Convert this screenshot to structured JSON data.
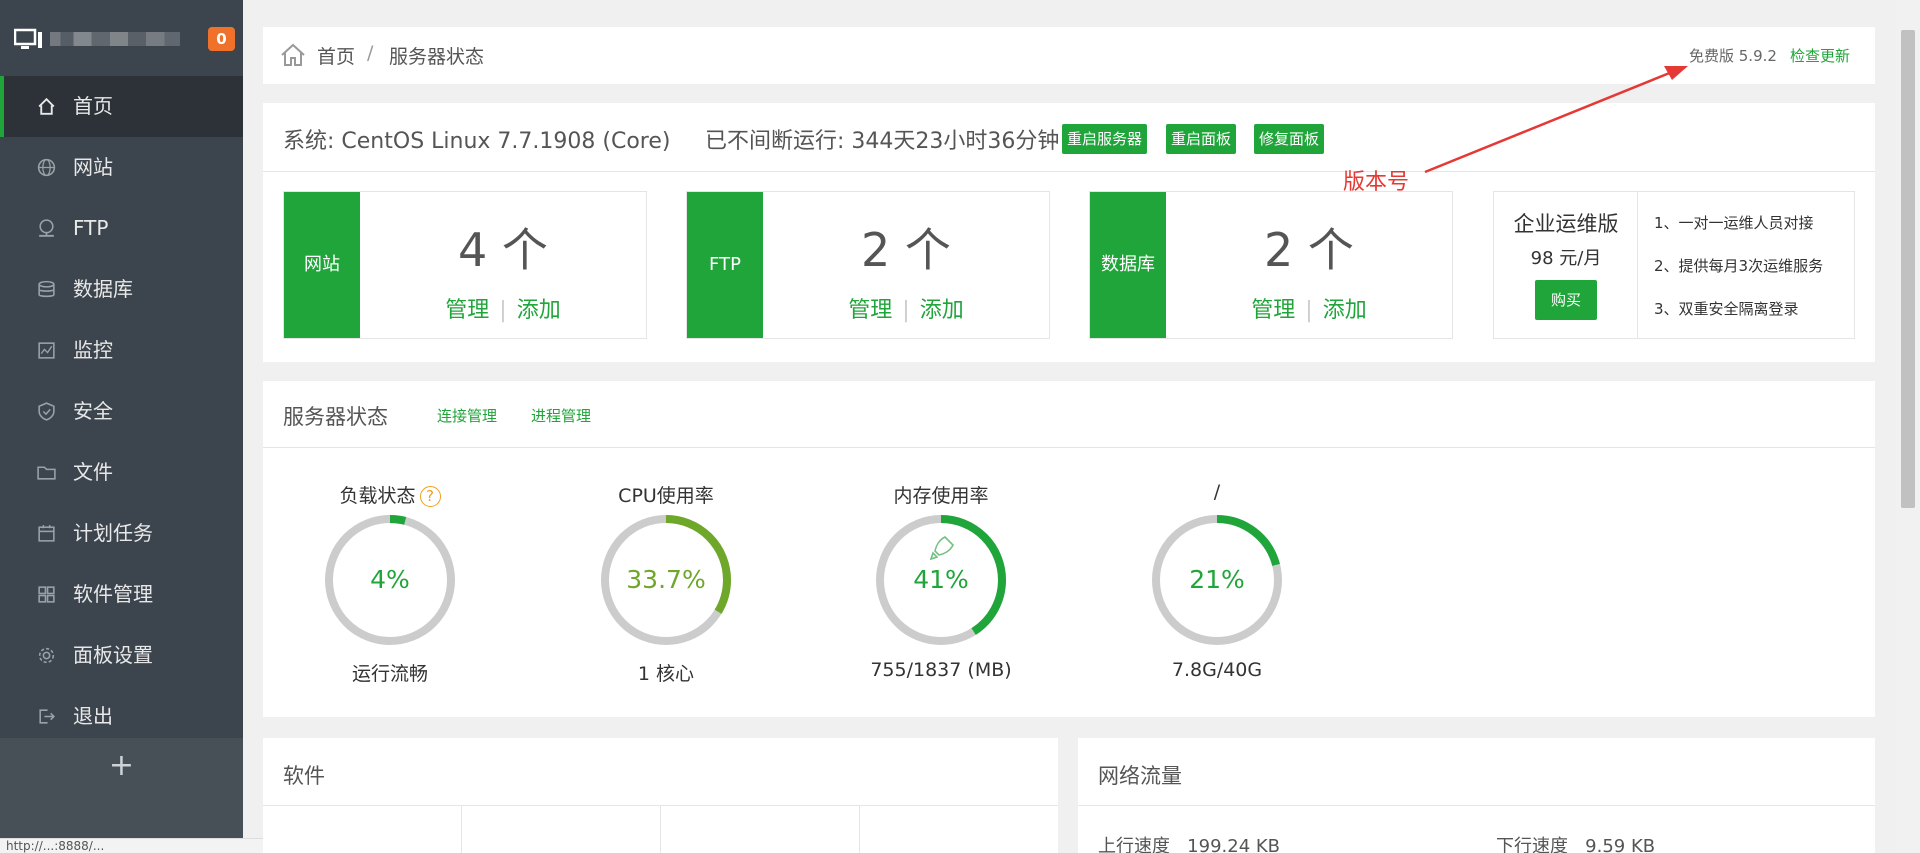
{
  "sidebar": {
    "badge": "0",
    "items": [
      {
        "label": "首页",
        "icon": "home-icon"
      },
      {
        "label": "网站",
        "icon": "globe-icon"
      },
      {
        "label": "FTP",
        "icon": "ftp-icon"
      },
      {
        "label": "数据库",
        "icon": "database-icon"
      },
      {
        "label": "监控",
        "icon": "monitor-chart-icon"
      },
      {
        "label": "安全",
        "icon": "shield-icon"
      },
      {
        "label": "文件",
        "icon": "folder-icon"
      },
      {
        "label": "计划任务",
        "icon": "calendar-icon"
      },
      {
        "label": "软件管理",
        "icon": "grid-icon"
      },
      {
        "label": "面板设置",
        "icon": "gear-icon"
      },
      {
        "label": "退出",
        "icon": "logout-icon"
      }
    ],
    "add_label": "+"
  },
  "breadcrumb": {
    "home": "首页",
    "separator": "/",
    "current": "服务器状态",
    "version": "免费版 5.9.2",
    "update_link": "检查更新"
  },
  "system": {
    "os": "系统: CentOS Linux 7.7.1908 (Core)",
    "uptime": "已不间断运行: 344天23小时36分钟",
    "buttons": [
      "重启服务器",
      "重启面板",
      "修复面板"
    ]
  },
  "stats": [
    {
      "label": "网站",
      "count": "4 个",
      "manage": "管理",
      "add": "添加"
    },
    {
      "label": "FTP",
      "count": "2 个",
      "manage": "管理",
      "add": "添加"
    },
    {
      "label": "数据库",
      "count": "2 个",
      "manage": "管理",
      "add": "添加"
    }
  ],
  "enterprise": {
    "name": "企业运维版",
    "price": "98 元/月",
    "buy": "购买",
    "features": [
      "1、一对一运维人员对接",
      "2、提供每月3次运维服务",
      "3、双重安全隔离登录"
    ]
  },
  "server_status": {
    "title": "服务器状态",
    "conn_link": "连接管理",
    "proc_link": "进程管理",
    "gauges": [
      {
        "title": "负载状态",
        "value": "4%",
        "percent": 4,
        "sub": "运行流畅",
        "color": "#20a53a"
      },
      {
        "title": "CPU使用率",
        "value": "33.7%",
        "percent": 33.7,
        "sub": "1 核心",
        "color": "#6ea72a"
      },
      {
        "title": "内存使用率",
        "value": "41%",
        "percent": 41,
        "sub": "755/1837 (MB)",
        "color": "#20a53a"
      },
      {
        "title": "/",
        "value": "21%",
        "percent": 21,
        "sub": "7.8G/40G",
        "color": "#20a53a"
      }
    ]
  },
  "software": {
    "title": "软件"
  },
  "network": {
    "title": "网络流量",
    "up_label": "上行速度",
    "up_value": "199.24 KB",
    "down_label": "下行速度",
    "down_value": "9.59 KB"
  },
  "annotation": {
    "text": "版本号",
    "color": "#e53935"
  },
  "colors": {
    "accent": "#20a53a",
    "sidebar": "#3c444d",
    "badge": "#f0722a"
  }
}
